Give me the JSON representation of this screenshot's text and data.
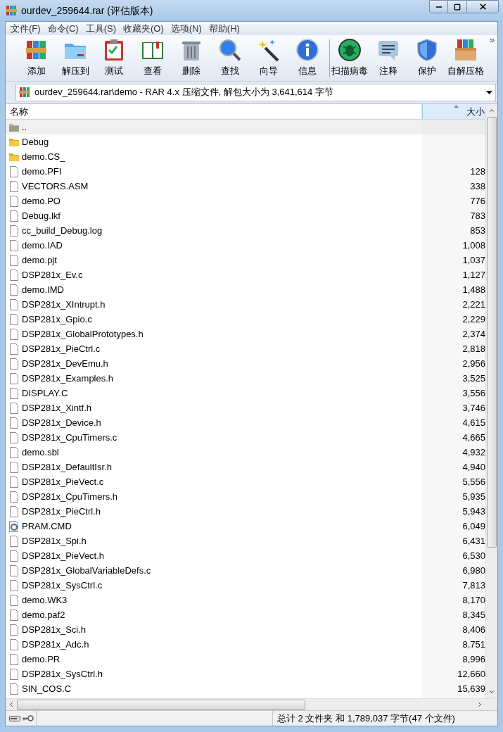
{
  "window": {
    "title": "ourdev_259644.rar (评估版本)"
  },
  "menu": [
    "文件(F)",
    "命令(C)",
    "工具(S)",
    "收藏夹(O)",
    "选项(N)",
    "帮助(H)"
  ],
  "toolbar": [
    {
      "kind": "add",
      "label": "添加"
    },
    {
      "kind": "extract",
      "label": "解压到"
    },
    {
      "kind": "test",
      "label": "测试"
    },
    {
      "kind": "view",
      "label": "查看"
    },
    {
      "kind": "delete",
      "label": "删除"
    },
    {
      "kind": "find",
      "label": "查找"
    },
    {
      "kind": "wizard",
      "label": "向导"
    },
    {
      "kind": "info",
      "label": "信息"
    },
    {
      "kind": "scan",
      "label": "扫描病毒"
    },
    {
      "kind": "comment",
      "label": "注释"
    },
    {
      "kind": "protect",
      "label": "保护"
    },
    {
      "kind": "sfx",
      "label": "自解压格"
    }
  ],
  "address": {
    "value": "ourdev_259644.rar\\demo - RAR 4.x 压缩文件, 解包大小为 3,641,614 字节"
  },
  "table": {
    "columns": [
      "名称",
      "大小"
    ],
    "rows": [
      {
        "kind": "parent",
        "name": "..",
        "selected": true
      },
      {
        "kind": "folder",
        "name": "Debug",
        "selected": false
      },
      {
        "kind": "folder",
        "name": "demo.CS_",
        "selected": false
      },
      {
        "kind": "file",
        "name": "demo.PFI",
        "size": "128",
        "selected": false
      },
      {
        "kind": "file",
        "name": "VECTORS.ASM",
        "size": "338",
        "selected": false
      },
      {
        "kind": "file",
        "name": "demo.PO",
        "size": "776",
        "selected": false
      },
      {
        "kind": "file",
        "name": "Debug.lkf",
        "size": "783",
        "selected": false
      },
      {
        "kind": "file",
        "name": "cc_build_Debug.log",
        "size": "853",
        "selected": false
      },
      {
        "kind": "file",
        "name": "demo.IAD",
        "size": "1,008",
        "selected": false
      },
      {
        "kind": "file",
        "name": "demo.pjt",
        "size": "1,037",
        "selected": false
      },
      {
        "kind": "file",
        "name": "DSP281x_Ev.c",
        "size": "1,127",
        "selected": false
      },
      {
        "kind": "file",
        "name": "demo.IMD",
        "size": "1,488",
        "selected": false
      },
      {
        "kind": "file",
        "name": "DSP281x_XIntrupt.h",
        "size": "2,221",
        "selected": false
      },
      {
        "kind": "file",
        "name": "DSP281x_Gpio.c",
        "size": "2,229",
        "selected": false
      },
      {
        "kind": "file",
        "name": "DSP281x_GlobalPrototypes.h",
        "size": "2,374",
        "selected": false
      },
      {
        "kind": "file",
        "name": "DSP281x_PieCtrl.c",
        "size": "2,818",
        "selected": false
      },
      {
        "kind": "file",
        "name": "DSP281x_DevEmu.h",
        "size": "2,956",
        "selected": false
      },
      {
        "kind": "file",
        "name": "DSP281x_Examples.h",
        "size": "3,525",
        "selected": false
      },
      {
        "kind": "file",
        "name": "DISPLAY.C",
        "size": "3,556",
        "selected": false
      },
      {
        "kind": "file",
        "name": "DSP281x_Xintf.h",
        "size": "3,746",
        "selected": false
      },
      {
        "kind": "file",
        "name": "DSP281x_Device.h",
        "size": "4,615",
        "selected": false
      },
      {
        "kind": "file",
        "name": "DSP281x_CpuTimers.c",
        "size": "4,665",
        "selected": false
      },
      {
        "kind": "file",
        "name": "demo.sbl",
        "size": "4,932",
        "selected": false
      },
      {
        "kind": "file",
        "name": "DSP281x_DefaultIsr.h",
        "size": "4,940",
        "selected": false
      },
      {
        "kind": "file",
        "name": "DSP281x_PieVect.c",
        "size": "5,556",
        "selected": false
      },
      {
        "kind": "file",
        "name": "DSP281x_CpuTimers.h",
        "size": "5,935",
        "selected": false
      },
      {
        "kind": "file",
        "name": "DSP281x_PieCtrl.h",
        "size": "5,943",
        "selected": false
      },
      {
        "kind": "cmd",
        "name": "PRAM.CMD",
        "size": "6,049",
        "selected": false
      },
      {
        "kind": "file",
        "name": "DSP281x_Spi.h",
        "size": "6,431",
        "selected": false
      },
      {
        "kind": "file",
        "name": "DSP281x_PieVect.h",
        "size": "6,530",
        "selected": false
      },
      {
        "kind": "file",
        "name": "DSP281x_GlobalVariableDefs.c",
        "size": "6,980",
        "selected": false
      },
      {
        "kind": "file",
        "name": "DSP281x_SysCtrl.c",
        "size": "7,813",
        "selected": false
      },
      {
        "kind": "file",
        "name": "demo.WK3",
        "size": "8,170",
        "selected": false
      },
      {
        "kind": "file",
        "name": "demo.paf2",
        "size": "8,345",
        "selected": false
      },
      {
        "kind": "file",
        "name": "DSP281x_Sci.h",
        "size": "8,406",
        "selected": false
      },
      {
        "kind": "file",
        "name": "DSP281x_Adc.h",
        "size": "8,751",
        "selected": false
      },
      {
        "kind": "file",
        "name": "demo.PR",
        "size": "8,996",
        "selected": false
      },
      {
        "kind": "file",
        "name": "DSP281x_SysCtrl.h",
        "size": "12,660",
        "selected": false
      },
      {
        "kind": "file",
        "name": "SIN_COS.C",
        "size": "15,639",
        "selected": false
      }
    ]
  },
  "status_bar": {
    "text": "总计 2 文件夹 和 1,789,037 字节(47 个文件)"
  }
}
